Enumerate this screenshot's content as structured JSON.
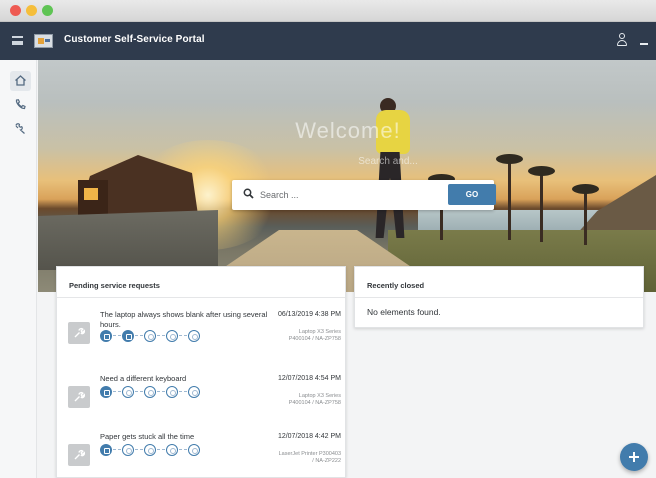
{
  "window": {
    "controls": [
      "close",
      "minimize",
      "zoom"
    ]
  },
  "shellbar": {
    "title": "Customer Self-Service Portal",
    "menu_icon": "hamburger-icon",
    "logo": "company-logo",
    "user_icon": "user-icon",
    "minimize_icon": "minimize-icon"
  },
  "sidenav": {
    "items": [
      {
        "icon": "home-icon",
        "active": true
      },
      {
        "icon": "phone-icon",
        "active": false
      },
      {
        "icon": "wrench-icon",
        "active": false
      }
    ]
  },
  "hero": {
    "title": "Welcome!",
    "subtitle": "Search and...",
    "search": {
      "placeholder": "Search ...",
      "value": ""
    },
    "go_label": "GO"
  },
  "pending": {
    "title": "Pending service requests",
    "items": [
      {
        "title": "The laptop always shows blank after using several hours.",
        "date": "06/13/2019 4:38 PM",
        "product": "Laptop X3 Series P400104 / NA-ZP758",
        "completed_steps": 2,
        "total_steps": 5
      },
      {
        "title": "Need a different keyboard",
        "date": "12/07/2018 4:54 PM",
        "product": "Laptop X3 Series P400104 / NA-ZP758",
        "completed_steps": 1,
        "total_steps": 5
      },
      {
        "title": "Paper gets stuck all the time",
        "date": "12/07/2018 4:42 PM",
        "product": "LaserJet Printer P300403 / NA-ZP222",
        "completed_steps": 1,
        "total_steps": 5
      }
    ]
  },
  "closed": {
    "title": "Recently closed",
    "empty_text": "No elements found."
  },
  "fab": {
    "icon": "plus-icon"
  },
  "colors": {
    "shellbar": "#2f3b4d",
    "accent": "#427cac",
    "background": "#f3f4f5"
  }
}
